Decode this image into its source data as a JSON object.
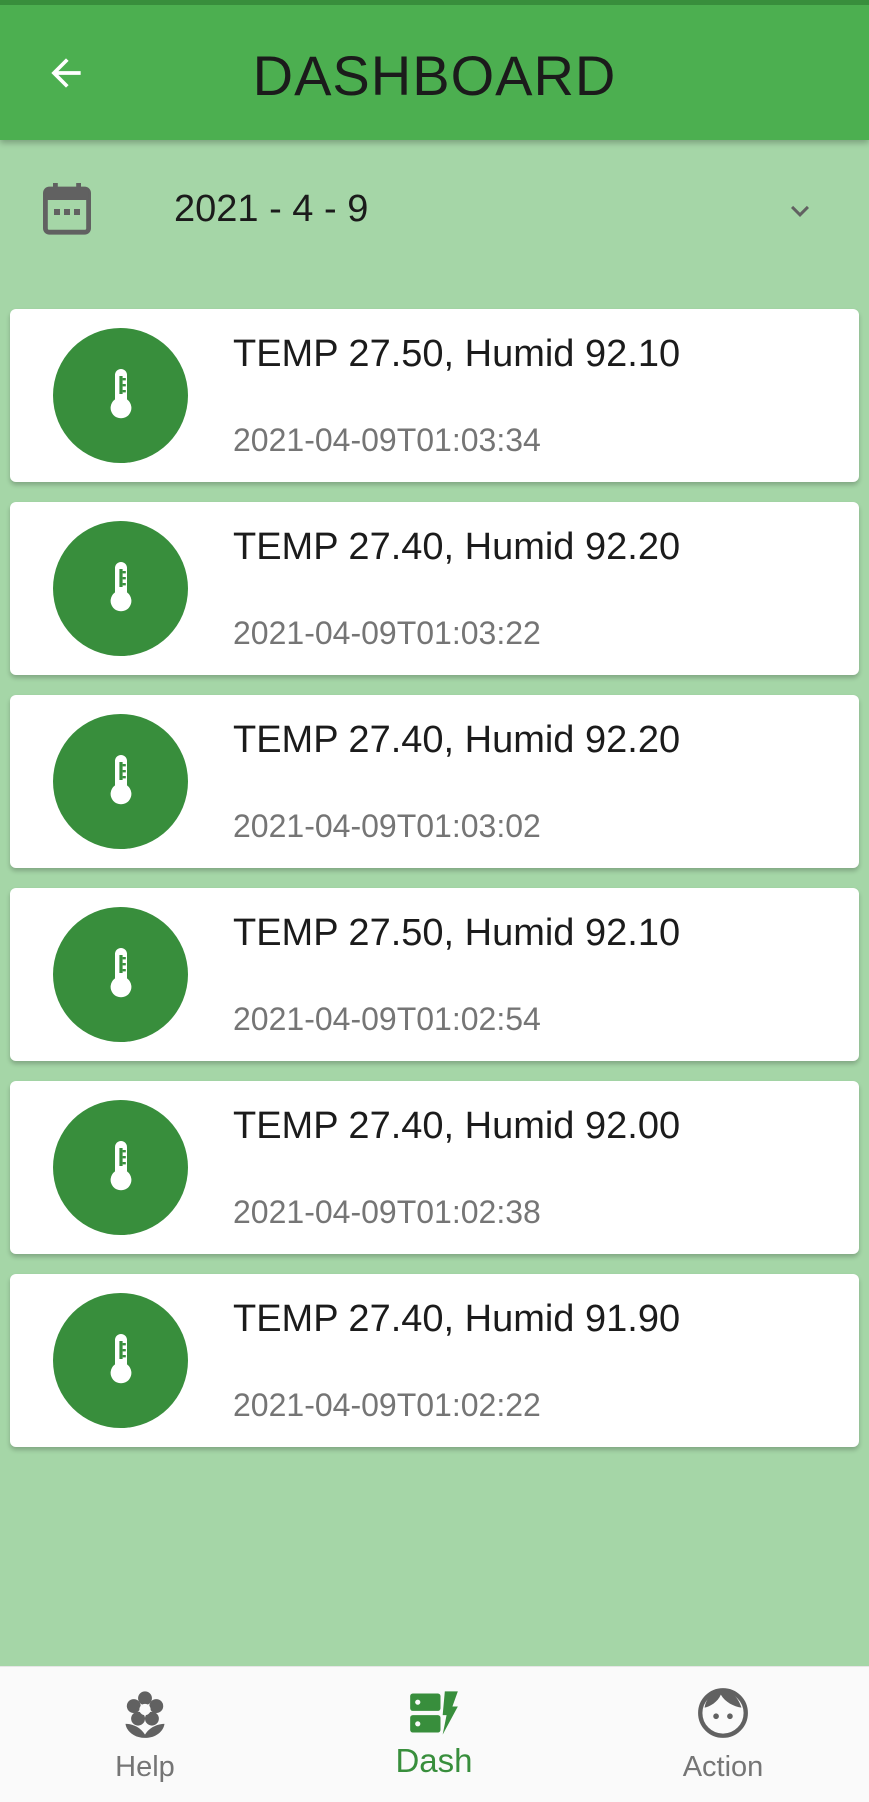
{
  "header": {
    "title": "DASHBOARD"
  },
  "date_picker": {
    "value": "2021 - 4 - 9"
  },
  "readings": [
    {
      "title": "TEMP 27.50, Humid 92.10",
      "timestamp": "2021-04-09T01:03:34"
    },
    {
      "title": "TEMP 27.40, Humid 92.20",
      "timestamp": "2021-04-09T01:03:22"
    },
    {
      "title": "TEMP 27.40, Humid 92.20",
      "timestamp": "2021-04-09T01:03:02"
    },
    {
      "title": "TEMP 27.50, Humid 92.10",
      "timestamp": "2021-04-09T01:02:54"
    },
    {
      "title": "TEMP 27.40, Humid 92.00",
      "timestamp": "2021-04-09T01:02:38"
    },
    {
      "title": "TEMP 27.40, Humid 91.90",
      "timestamp": "2021-04-09T01:02:22"
    }
  ],
  "bottom_nav": {
    "items": [
      {
        "label": "Help",
        "icon": "flower-icon"
      },
      {
        "label": "Dash",
        "icon": "dashboard-icon",
        "active": true
      },
      {
        "label": "Action",
        "icon": "face-icon"
      }
    ]
  },
  "colors": {
    "app_bar": "#4caf50",
    "app_bar_top_strip": "#388e3c",
    "background": "#a5d6a7",
    "avatar": "#388e3c",
    "active_nav": "#388e3c",
    "inactive_nav": "#757575"
  }
}
